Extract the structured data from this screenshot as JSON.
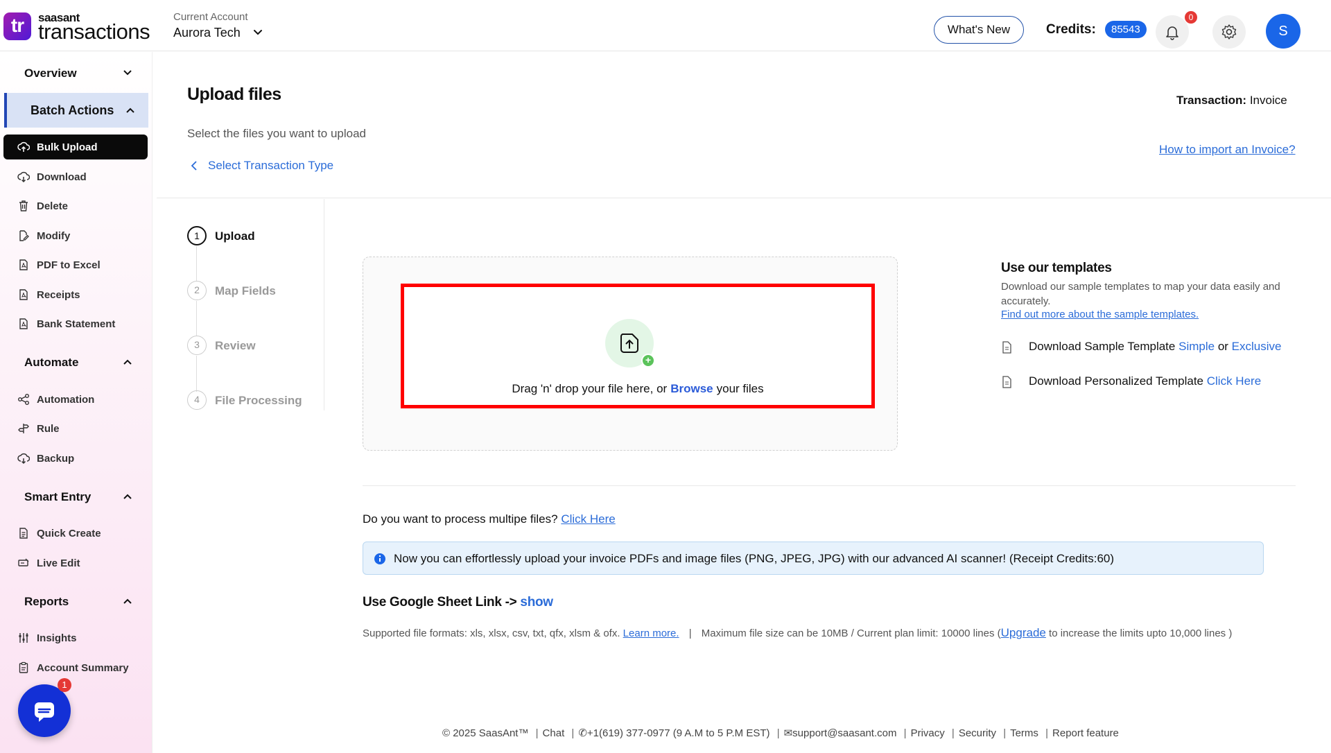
{
  "header": {
    "logo_mark": "tr",
    "brand_top": "saasant",
    "brand_main": "transactions",
    "account_label": "Current Account",
    "account_name": "Aurora Tech",
    "whats_new": "What's New",
    "credits_label": "Credits:",
    "credits_value": "85543",
    "notifications_count": "0",
    "avatar_initial": "S"
  },
  "sidebar": {
    "overview": "Overview",
    "batch_actions": "Batch Actions",
    "batch_items": [
      "Bulk Upload",
      "Download",
      "Delete",
      "Modify",
      "PDF to Excel",
      "Receipts",
      "Bank Statement"
    ],
    "automate": "Automate",
    "automate_items": [
      "Automation",
      "Rule",
      "Backup"
    ],
    "smart_entry": "Smart Entry",
    "smart_items": [
      "Quick Create",
      "Live Edit"
    ],
    "reports": "Reports",
    "report_items": [
      "Insights",
      "Account Summary"
    ],
    "chat_badge": "1"
  },
  "main": {
    "title": "Upload files",
    "subtitle": "Select the files you want to upload",
    "back_link": "Select Transaction Type",
    "transaction_label": "Transaction:",
    "transaction_value": "Invoice",
    "how_to_link": "How to import an Invoice?",
    "steps": [
      {
        "num": "1",
        "label": "Upload"
      },
      {
        "num": "2",
        "label": "Map Fields"
      },
      {
        "num": "3",
        "label": "Review"
      },
      {
        "num": "4",
        "label": "File Processing"
      }
    ],
    "dropzone": {
      "text_before": "Drag 'n' drop your file here, or",
      "browse": "Browse",
      "text_after": "your files",
      "plus": "+"
    },
    "templates": {
      "title": "Use our templates",
      "description": "Download our sample templates to map your data easily and accurately.",
      "more_link": "Find out more about the sample templates.",
      "sample_prefix": "Download Sample Template",
      "sample_simple": "Simple",
      "sample_or": "or",
      "sample_exclusive": "Exclusive",
      "personalized_prefix": "Download Personalized Template",
      "personalized_link": "Click Here"
    },
    "multi_question": "Do you want to process multipe files?",
    "multi_link": "Click Here",
    "info_banner": "Now you can effortlessly upload your invoice PDFs and image files (PNG, JPEG, JPG) with our advanced AI scanner! (Receipt Credits:60)",
    "gsheet_label": "Use Google Sheet Link ->",
    "gsheet_show": "show",
    "formats_text": "Supported file formats: xls, xlsx, csv, txt, qfx, xlsm & ofx.",
    "formats_learn": "Learn more.",
    "limits_text": "Maximum file size can be 10MB / Current plan limit: 10000 lines (",
    "limits_upgrade": "Upgrade",
    "limits_after": "to increase the limits upto 10,000 lines )"
  },
  "footer": {
    "copyright": "© 2025 SaasAnt™",
    "chat": "Chat",
    "phone": "+1(619) 377-0977 (9 A.M to 5 P.M EST)",
    "email": "support@saasant.com",
    "privacy": "Privacy",
    "security": "Security",
    "terms": "Terms",
    "report": "Report feature"
  }
}
